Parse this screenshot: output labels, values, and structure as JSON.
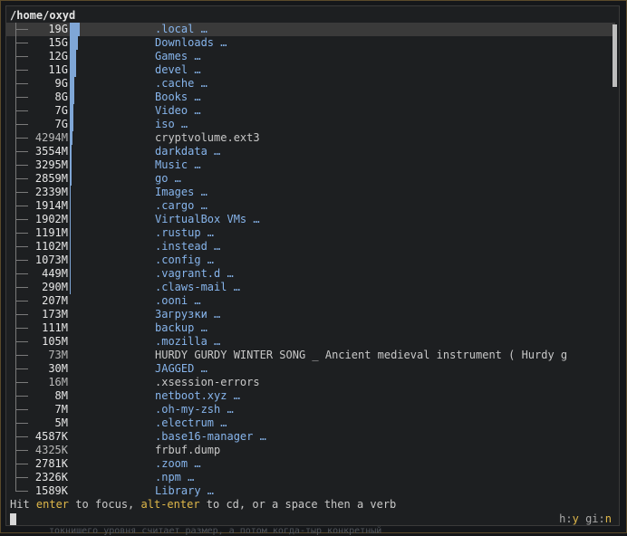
{
  "path": "/home/oxyd",
  "rows": [
    {
      "size": "19G",
      "name": ".local …",
      "kind": "dir",
      "share": 0.13,
      "selected": true
    },
    {
      "size": "15G",
      "name": "Downloads …",
      "kind": "dir",
      "share": 0.105
    },
    {
      "size": "12G",
      "name": "Games …",
      "kind": "dir",
      "share": 0.085
    },
    {
      "size": "11G",
      "name": "devel …",
      "kind": "dir",
      "share": 0.078
    },
    {
      "size": "9G",
      "name": ".cache …",
      "kind": "dir",
      "share": 0.064
    },
    {
      "size": "8G",
      "name": "Books …",
      "kind": "dir",
      "share": 0.057
    },
    {
      "size": "7G",
      "name": "Video …",
      "kind": "dir",
      "share": 0.05
    },
    {
      "size": "7G",
      "name": "iso …",
      "kind": "dir",
      "share": 0.05
    },
    {
      "size": "4294M",
      "name": "cryptvolume.ext3",
      "kind": "file",
      "share": 0.03
    },
    {
      "size": "3554M",
      "name": "darkdata …",
      "kind": "dir",
      "share": 0.025
    },
    {
      "size": "3295M",
      "name": "Music …",
      "kind": "dir",
      "share": 0.023
    },
    {
      "size": "2859M",
      "name": "go …",
      "kind": "dir",
      "share": 0.02
    },
    {
      "size": "2339M",
      "name": "Images …",
      "kind": "dir",
      "share": 0.017
    },
    {
      "size": "1914M",
      "name": ".cargo …",
      "kind": "dir",
      "share": 0.014
    },
    {
      "size": "1902M",
      "name": "VirtualBox VMs …",
      "kind": "dir",
      "share": 0.014
    },
    {
      "size": "1191M",
      "name": ".rustup …",
      "kind": "dir",
      "share": 0.009
    },
    {
      "size": "1102M",
      "name": ".instead …",
      "kind": "dir",
      "share": 0.008
    },
    {
      "size": "1073M",
      "name": ".config …",
      "kind": "dir",
      "share": 0.008
    },
    {
      "size": "449M",
      "name": ".vagrant.d …",
      "kind": "dir",
      "share": 0.003
    },
    {
      "size": "290M",
      "name": ".claws-mail …",
      "kind": "dir",
      "share": 0.002
    },
    {
      "size": "207M",
      "name": ".ooni …",
      "kind": "dir",
      "share": 0.0
    },
    {
      "size": "173M",
      "name": "Загрузки …",
      "kind": "dir",
      "share": 0.0
    },
    {
      "size": "111M",
      "name": "backup …",
      "kind": "dir",
      "share": 0.0
    },
    {
      "size": "105M",
      "name": ".mozilla …",
      "kind": "dir",
      "share": 0.0
    },
    {
      "size": "73M",
      "name": "HURDY GURDY WINTER SONG _ Ancient medieval instrument ( Hurdy g",
      "kind": "file",
      "share": 0.0
    },
    {
      "size": "30M",
      "name": "JAGGED …",
      "kind": "dir",
      "share": 0.0
    },
    {
      "size": "16M",
      "name": ".xsession-errors",
      "kind": "file",
      "share": 0.0
    },
    {
      "size": "8M",
      "name": "netboot.xyz …",
      "kind": "dir",
      "share": 0.0
    },
    {
      "size": "7M",
      "name": ".oh-my-zsh …",
      "kind": "dir",
      "share": 0.0
    },
    {
      "size": "5M",
      "name": ".electrum …",
      "kind": "dir",
      "share": 0.0
    },
    {
      "size": "4587K",
      "name": ".base16-manager …",
      "kind": "dir",
      "share": 0.0
    },
    {
      "size": "4325K",
      "name": "frbuf.dump",
      "kind": "file",
      "share": 0.0
    },
    {
      "size": "2781K",
      "name": ".zoom …",
      "kind": "dir",
      "share": 0.0
    },
    {
      "size": "2326K",
      "name": ".npm …",
      "kind": "dir",
      "share": 0.0
    },
    {
      "size": "1589K",
      "name": "Library …",
      "kind": "dir",
      "share": 0.0
    }
  ],
  "status": {
    "hit": "Hit ",
    "enter": "enter",
    "to_focus": " to focus, ",
    "alt_enter": "alt-enter",
    "rest": " to cd, or a space then a verb"
  },
  "flags": {
    "h_label": "h:",
    "h_value": "y",
    "gi_label": "gi:",
    "gi_value": "n"
  },
  "scroll": {
    "position": 0.0,
    "visible_fraction": 0.13
  },
  "colors": {
    "bar": "#7fa6d6",
    "dir": "#87b5ec",
    "key": "#e0b84a"
  },
  "background_text": "токнишего уровня считает размер, а потом когда-тыр конкретный"
}
